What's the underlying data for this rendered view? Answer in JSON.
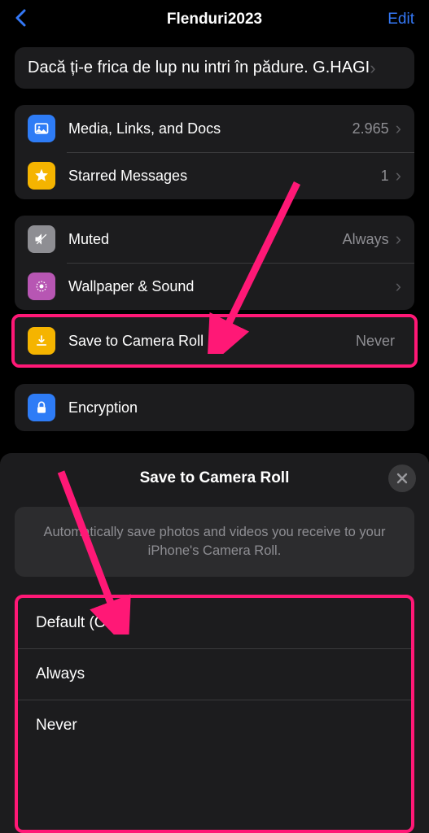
{
  "nav": {
    "title": "Flenduri2023",
    "edit": "Edit"
  },
  "status": {
    "text": "Dacă ți-e frica de lup nu intri în pădure. G.HAGI"
  },
  "rows": {
    "media": {
      "label": "Media, Links, and Docs",
      "value": "2.965"
    },
    "starred": {
      "label": "Starred Messages",
      "value": "1"
    },
    "muted": {
      "label": "Muted",
      "value": "Always"
    },
    "wallpaper": {
      "label": "Wallpaper & Sound"
    },
    "save": {
      "label": "Save to Camera Roll",
      "value": "Never"
    },
    "encryption": {
      "label": "Encryption"
    }
  },
  "sheet": {
    "title": "Save to Camera Roll",
    "desc": "Automatically save photos and videos you receive to your iPhone's Camera Roll.",
    "options": [
      "Default (On)",
      "Always",
      "Never"
    ]
  },
  "colors": {
    "media": "#2e7cf6",
    "star": "#f5b400",
    "muted": "#8e8e93",
    "wallpaper": "#b756b3",
    "save": "#f5b400",
    "lock": "#2e7cf6"
  }
}
